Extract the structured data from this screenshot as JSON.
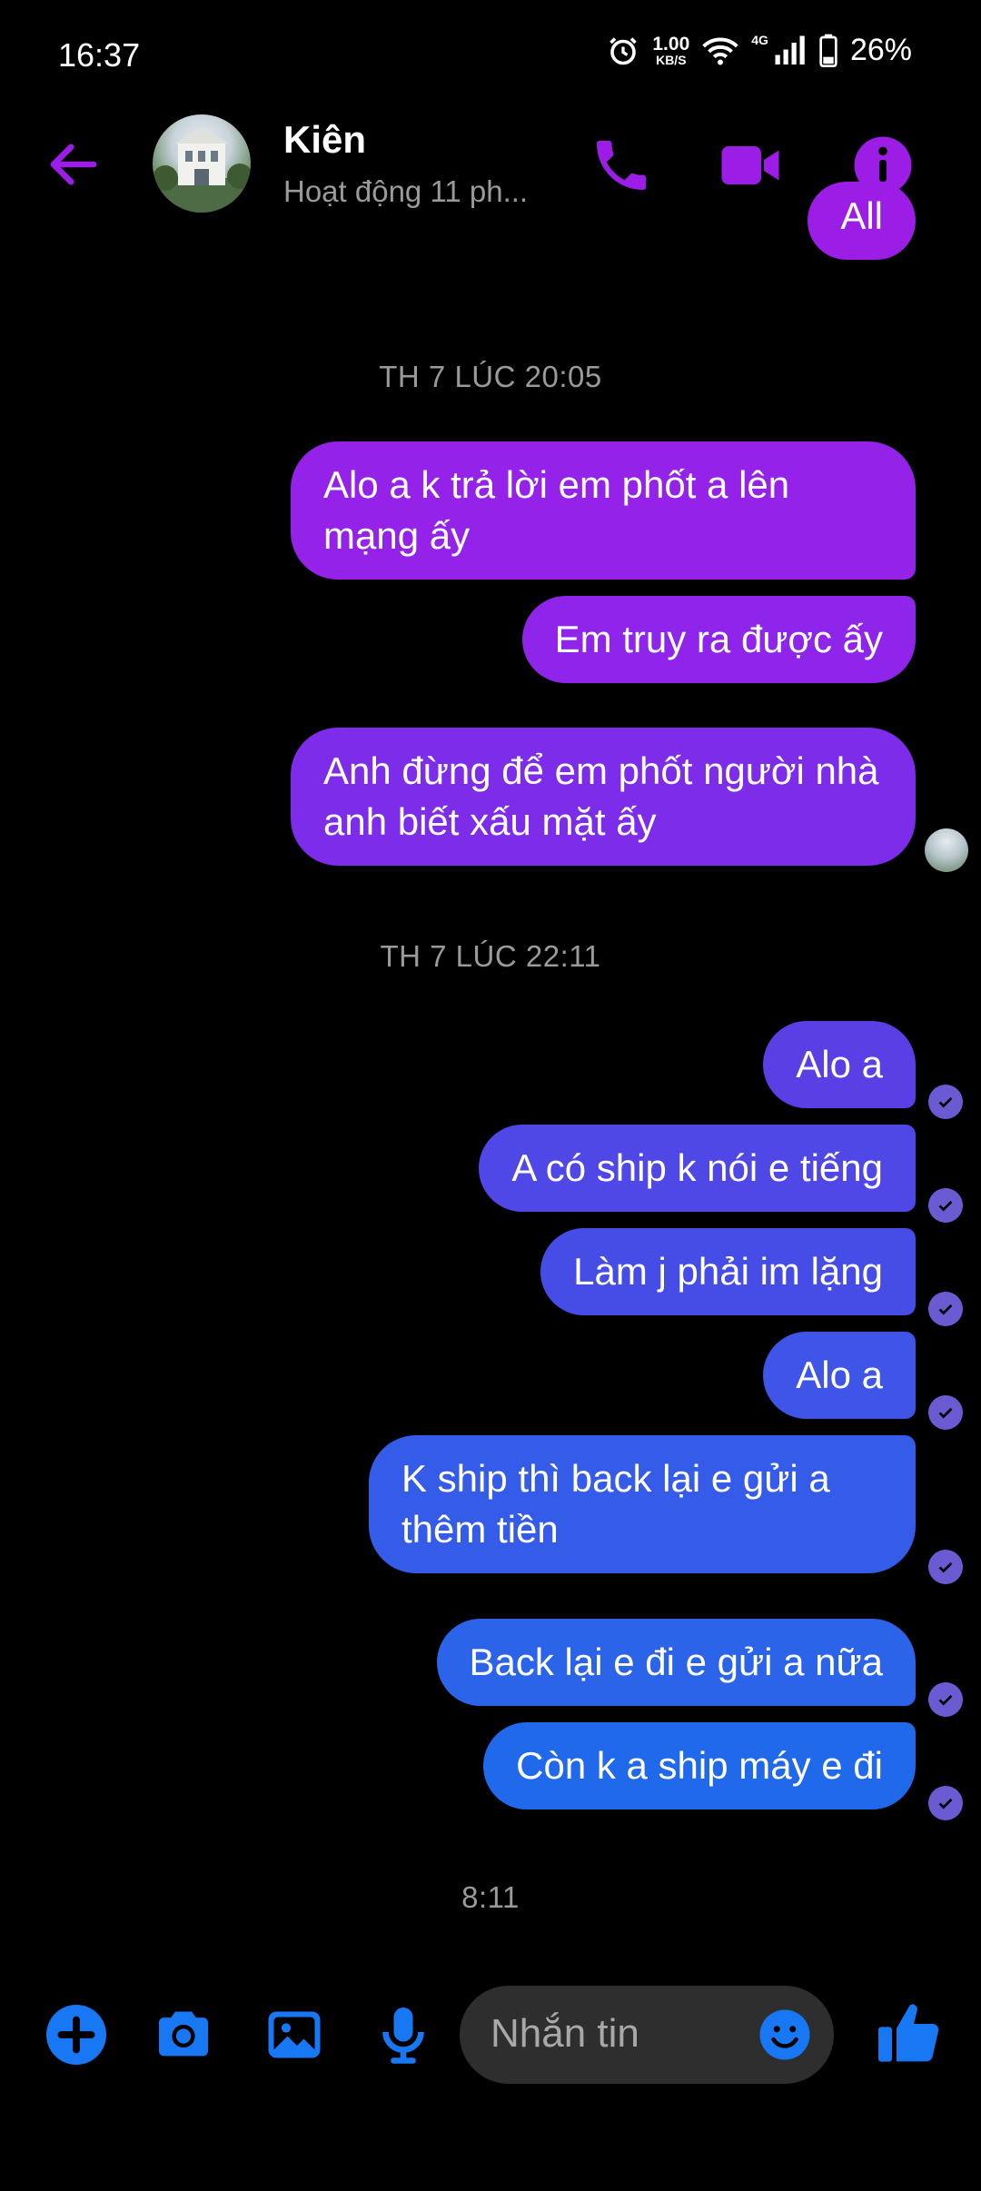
{
  "status_bar": {
    "time": "16:37",
    "net_speed_value": "1.00",
    "net_speed_unit": "KB/S",
    "network_label": "4G",
    "battery": "26%",
    "icons": [
      "alarm-icon",
      "wifi-icon",
      "signal-icon",
      "battery-icon"
    ]
  },
  "header": {
    "name": "Kiên",
    "status": "Hoạt động 11 ph...",
    "icons": [
      "back-arrow-icon",
      "phone-icon",
      "video-camera-icon",
      "info-icon"
    ]
  },
  "conversation": {
    "partial_top_message": "All",
    "time_separators": [
      "TH 7 LÚC 20:05",
      "TH 7 LÚC 22:11",
      "8:11"
    ],
    "messages": [
      "Alo a k trả lời em phốt a lên mạng ấy",
      "Em truy ra được ấy",
      "Anh đừng để em phốt người nhà anh biết xấu mặt ấy",
      "Alo a",
      "A có ship k nói e tiếng",
      "Làm j phải im lặng",
      "Alo a",
      "K ship thì back lại e gửi a thêm tiền",
      "Back lại e đi e gửi a nữa",
      "Còn k a ship máy e đi"
    ]
  },
  "composer": {
    "placeholder": "Nhắn tin",
    "icons": [
      "plus-icon",
      "camera-icon",
      "gallery-icon",
      "microphone-icon",
      "emoji-icon",
      "thumbs-up-icon"
    ]
  },
  "colors": {
    "accent_purple": "#9b1de6",
    "accent_blue": "#1877f2",
    "bubble_top": "#9420e8",
    "bubble_bottom": "#1f6eea"
  }
}
